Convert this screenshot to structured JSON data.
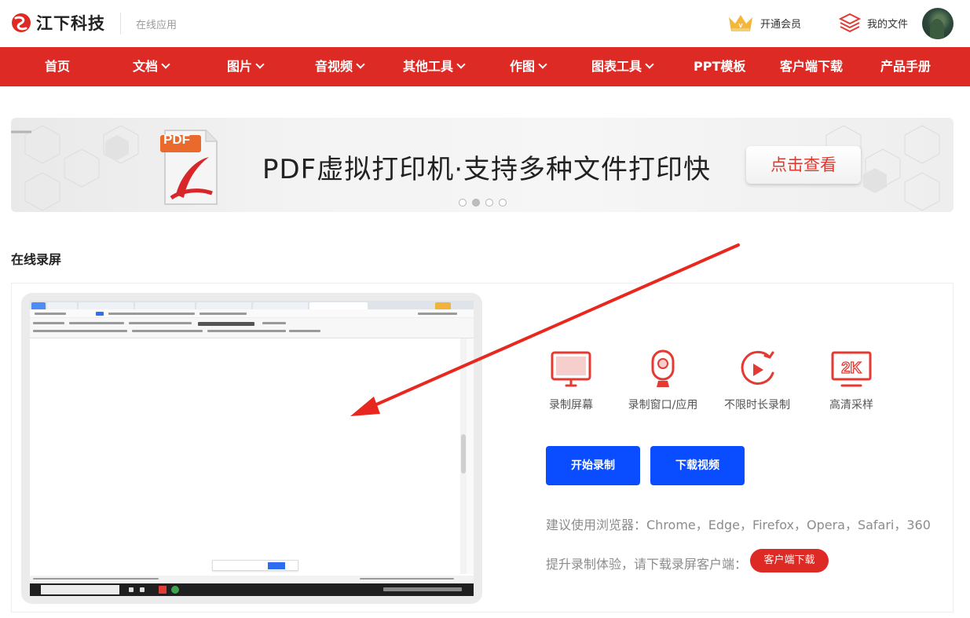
{
  "header": {
    "brand": "江下科技",
    "subtitle": "在线应用",
    "vip_label": "开通会员",
    "myfiles_label": "我的文件"
  },
  "nav": {
    "items": [
      {
        "label": "首页",
        "dropdown": false
      },
      {
        "label": "文档",
        "dropdown": true
      },
      {
        "label": "图片",
        "dropdown": true
      },
      {
        "label": "音视频",
        "dropdown": true
      },
      {
        "label": "其他工具",
        "dropdown": true
      },
      {
        "label": "作图",
        "dropdown": true
      },
      {
        "label": "图表工具",
        "dropdown": true
      },
      {
        "label": "PPT模板",
        "dropdown": false
      },
      {
        "label": "客户端下载",
        "dropdown": false
      },
      {
        "label": "产品手册",
        "dropdown": false
      }
    ]
  },
  "banner": {
    "badge": "PDF",
    "title": "PDF虚拟打印机·支持多种文件打印快",
    "button": "点击查看",
    "dot_count": 4,
    "active_dot": 1
  },
  "section": {
    "title": "在线录屏"
  },
  "features": [
    {
      "label": "录制屏幕",
      "icon": "monitor-icon"
    },
    {
      "label": "录制窗口/应用",
      "icon": "webcam-icon"
    },
    {
      "label": "不限时长录制",
      "icon": "play-circle-icon"
    },
    {
      "label": "高清采样",
      "icon": "2k-icon"
    }
  ],
  "feature_icon_text": "2K",
  "actions": {
    "start": "开始录制",
    "download": "下载视频"
  },
  "hints": {
    "browsers": "建议使用浏览器：Chrome，Edge，Firefox，Opera，Safari，360",
    "client": "提升录制体验，请下载录屏客户端："
  },
  "client_button": "客户端下载",
  "colors": {
    "brand_red": "#dd2a24",
    "primary_blue": "#0a4cff"
  }
}
